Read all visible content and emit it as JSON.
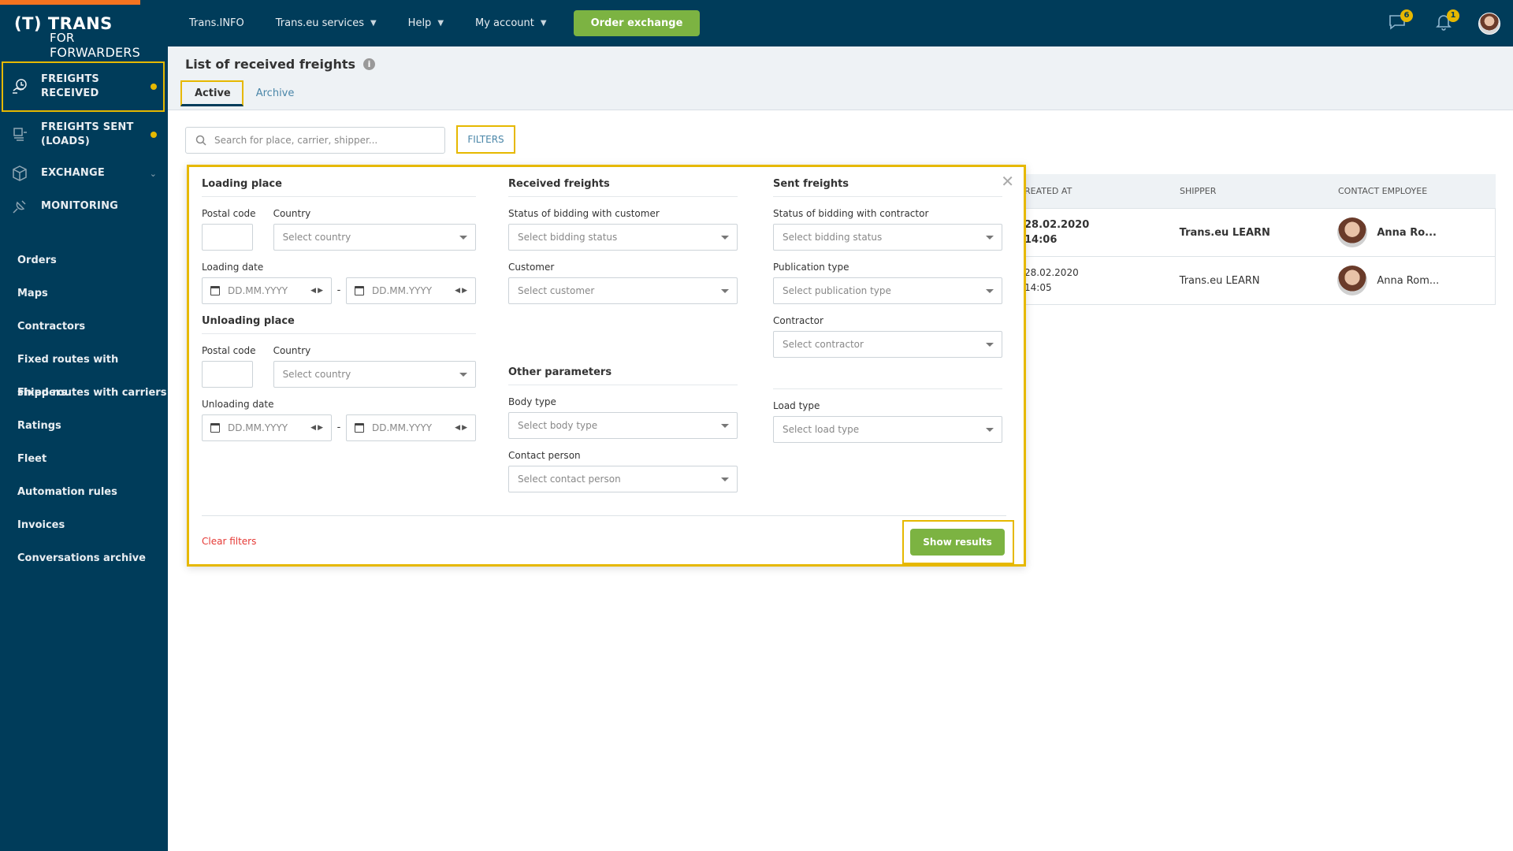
{
  "brand": {
    "line1": "(T) TRANS",
    "line2_a": "FOR",
    "line2_b": "FORWARDERS"
  },
  "sidebar": {
    "main": [
      {
        "label": "FREIGHTS RECEIVED",
        "icon": "freights-received-icon",
        "dot": true,
        "active": true
      },
      {
        "label": "FREIGHTS SENT (LOADS)",
        "icon": "freights-sent-icon",
        "dot": true
      },
      {
        "label": "EXCHANGE",
        "icon": "exchange-icon",
        "chevron": true
      },
      {
        "label": "MONITORING",
        "icon": "monitoring-icon"
      }
    ],
    "sub": [
      "Orders",
      "Maps",
      "Contractors",
      "Fixed routes with shippers",
      "Fixed routes with carriers",
      "Ratings",
      "Fleet",
      "Automation rules",
      "Invoices",
      "Conversations archive"
    ]
  },
  "topbar": {
    "links": [
      "Trans.INFO",
      "Trans.eu services",
      "Help",
      "My account"
    ],
    "order_button": "Order exchange",
    "messages_badge": "6",
    "notifications_badge": "1"
  },
  "page": {
    "title": "List of received freights",
    "tabs": [
      "Active",
      "Archive"
    ],
    "search_placeholder": "Search for place, carrier, shipper...",
    "filters_button": "FILTERS"
  },
  "table": {
    "headers": [
      "REATED AT",
      "SHIPPER",
      "CONTACT EMPLOYEE"
    ],
    "rows": [
      {
        "date": "28.02.2020",
        "time": "14:06",
        "shipper": "Trans.eu LEARN",
        "employee": "Anna Ro...",
        "bold": true
      },
      {
        "date": "28.02.2020",
        "time": "14:05",
        "shipper": "Trans.eu LEARN",
        "employee": "Anna Rom...",
        "bold": false
      }
    ]
  },
  "filters": {
    "loading": {
      "title": "Loading place",
      "postal_label": "Postal code",
      "country_label": "Country",
      "country_placeholder": "Select country",
      "date_label": "Loading date",
      "date_placeholder": "DD.MM.YYYY"
    },
    "unloading": {
      "title": "Unloading place",
      "postal_label": "Postal code",
      "country_label": "Country",
      "country_placeholder": "Select country",
      "date_label": "Unloading date",
      "date_placeholder": "DD.MM.YYYY"
    },
    "received": {
      "title": "Received freights",
      "bidding_label": "Status of bidding with customer",
      "bidding_placeholder": "Select bidding status",
      "customer_label": "Customer",
      "customer_placeholder": "Select customer"
    },
    "sent": {
      "title": "Sent freights",
      "bidding_label": "Status of bidding with contractor",
      "bidding_placeholder": "Select bidding status",
      "publication_label": "Publication type",
      "publication_placeholder": "Select publication type",
      "contractor_label": "Contractor",
      "contractor_placeholder": "Select contractor"
    },
    "other": {
      "title": "Other parameters",
      "body_label": "Body type",
      "body_placeholder": "Select body type",
      "load_label": "Load type",
      "load_placeholder": "Select load type",
      "contact_label": "Contact person",
      "contact_placeholder": "Select contact person"
    },
    "clear": "Clear filters",
    "show": "Show results"
  }
}
